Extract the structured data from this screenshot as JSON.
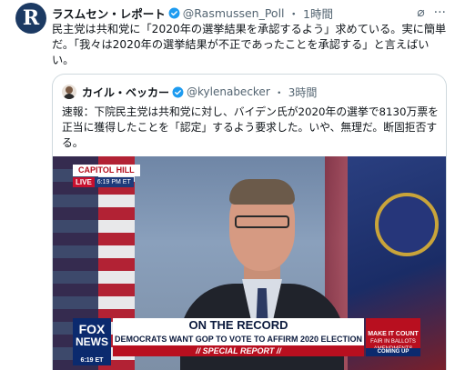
{
  "tweet": {
    "avatar_letter": "R",
    "name": "ラスムセン・レポート",
    "handle": "@Rasmussen_Poll",
    "separator": "・",
    "time": "1時間",
    "text": "民主党は共和党に「2020年の選挙結果を承認するよう」求めている。実に簡単だ。「我々は2020年の選挙結果が不正であったことを承認する」と言えばいい。"
  },
  "quote": {
    "name": "カイル・ベッカー",
    "handle": "@kylenabecker",
    "separator": "・",
    "time": "3時間",
    "text": "速報：下院民主党は共和党に対し、バイデン氏が2020年の選挙で8130万票を正当に獲得したことを「認定」するよう要求した。いや、無理だ。断固拒否する。"
  },
  "video": {
    "location_tag": "CAPITOL HILL",
    "live_label": "LIVE",
    "live_time": "6:19 PM ET",
    "network_line1": "FOX",
    "network_line2": "NEWS",
    "network_time": "6:19 ET",
    "segment_title": "ON THE RECORD",
    "headline": "DEMOCRATS WANT GOP TO VOTE TO AFFIRM 2020 ELECTION",
    "special_report": "// SPECIAL REPORT //",
    "promo_title": "MAKE IT COUNT",
    "promo_sub": "FAIR IN BALLOTS AMENDMENTS",
    "promo_coming": "COMING UP"
  },
  "icons": {
    "grok": "⌀",
    "more": "···"
  },
  "colors": {
    "verified": "#1d9bf0",
    "text": "#0f1419",
    "secondary": "#536471",
    "fox_red": "#b80f1f",
    "fox_blue": "#0b2a6e"
  }
}
